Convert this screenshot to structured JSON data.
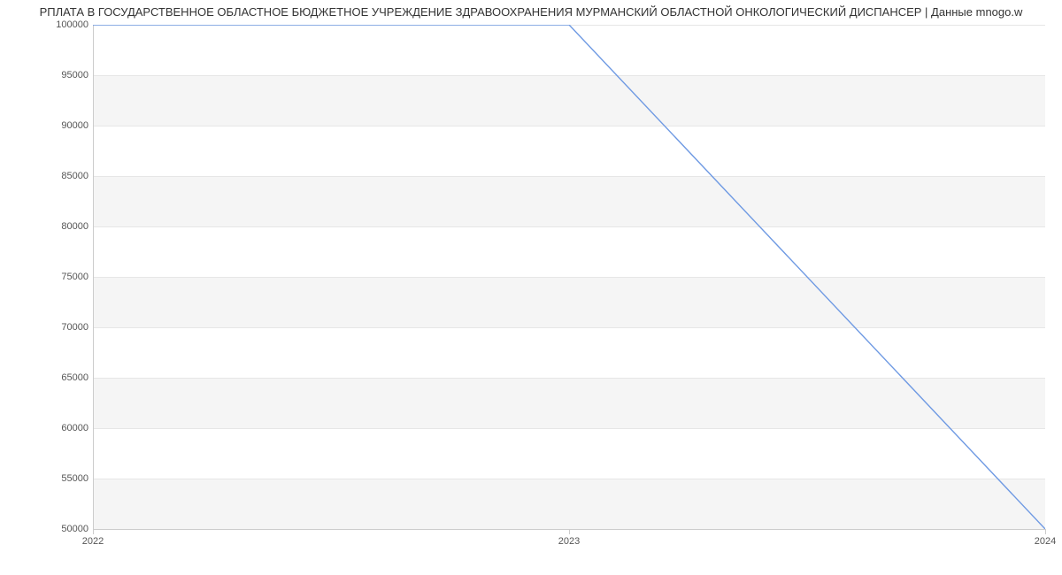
{
  "chart_data": {
    "type": "line",
    "title": "РПЛАТА В ГОСУДАРСТВЕННОЕ ОБЛАСТНОЕ БЮДЖЕТНОЕ УЧРЕЖДЕНИЕ ЗДРАВООХРАНЕНИЯ МУРМАНСКИЙ ОБЛАСТНОЙ ОНКОЛОГИЧЕСКИЙ ДИСПАНСЕР | Данные mnogo.w",
    "x": [
      2022,
      2023,
      2024
    ],
    "values": [
      100000,
      100000,
      50000
    ],
    "x_ticks": [
      "2022",
      "2023",
      "2024"
    ],
    "y_ticks": [
      50000,
      55000,
      60000,
      65000,
      70000,
      75000,
      80000,
      85000,
      90000,
      95000,
      100000
    ],
    "y_tick_labels": [
      "50000",
      "55000",
      "60000",
      "65000",
      "70000",
      "75000",
      "80000",
      "85000",
      "90000",
      "95000",
      "100000"
    ],
    "ylim": [
      50000,
      100000
    ],
    "xlim": [
      2022,
      2024
    ],
    "line_color": "#6f9ae3",
    "xlabel": "",
    "ylabel": ""
  }
}
